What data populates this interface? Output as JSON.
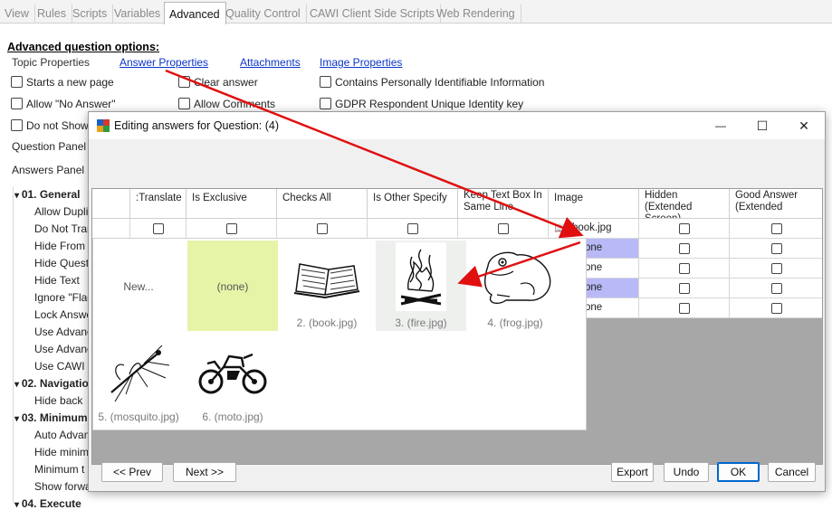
{
  "tabs": [
    "View",
    "Rules",
    "Scripts",
    "Variables",
    "Advanced",
    "Quality Control",
    "CAWI Client Side Scripts",
    "Web Rendering"
  ],
  "active_tab": "Advanced",
  "form": {
    "section_title": "Advanced question options:",
    "topic_properties": "Topic Properties",
    "links": [
      "Answer Properties",
      "Attachments",
      "Image Properties"
    ],
    "checkboxes": {
      "starts_new_page": "Starts a new page",
      "clear_answer": "Clear answer",
      "contains_pii": "Contains Personally Identifiable Information",
      "allow_no_answer": "Allow \"No Answer\"",
      "allow_comments": "Allow Comments",
      "gdpr_key": "GDPR Respondent Unique Identity key",
      "do_not_show": "Do not Show"
    },
    "question_panel": "Question Panel",
    "answers_panel": "Answers Panel H"
  },
  "tree": [
    {
      "text": "01. General",
      "header": true
    },
    {
      "text": "Allow Duplicate",
      "header": false
    },
    {
      "text": "Do Not Translate",
      "header": false
    },
    {
      "text": "Hide From",
      "header": false
    },
    {
      "text": "Hide Question",
      "header": false
    },
    {
      "text": "Hide Text",
      "header": false
    },
    {
      "text": "Ignore \"Flag",
      "header": false
    },
    {
      "text": "Lock Answers",
      "header": false
    },
    {
      "text": "Use Advanced",
      "header": false
    },
    {
      "text": "Use Advanced",
      "header": false
    },
    {
      "text": "Use CAWI E",
      "header": false
    },
    {
      "text": "02. Navigation",
      "header": true
    },
    {
      "text": "Hide back",
      "header": false
    },
    {
      "text": "03. Minimum",
      "header": true
    },
    {
      "text": "Auto Advance",
      "header": false
    },
    {
      "text": "Hide minimum",
      "header": false
    },
    {
      "text": "Minimum t",
      "header": false
    },
    {
      "text": "Show forward",
      "header": false
    },
    {
      "text": "04. Execute",
      "header": true
    }
  ],
  "dialog": {
    "title": "Editing answers for Question: (4)",
    "window_controls": {
      "minimize": "—",
      "maximize": "☐",
      "close": "✕"
    },
    "columns": [
      ":Translate",
      "Is Exclusive",
      "Checks All",
      "Is Other Specify",
      "Keep Text Box In Same Line",
      "Image",
      "Hidden (Extended Screen)",
      "Good Answer (Extended"
    ],
    "image_cells": [
      "book.jpg",
      "one",
      "one",
      "one",
      "one"
    ],
    "buttons": {
      "prev": "<< Prev",
      "next": "Next >>",
      "export": "Export",
      "undo": "Undo",
      "ok": "OK",
      "cancel": "Cancel"
    },
    "accent_color": "#0066cc",
    "selection_color": "#b9b9f8"
  },
  "picker": {
    "new_label": "New...",
    "none_label": "(none)",
    "none_color": "#e6f4a8",
    "images": [
      "2. (book.jpg)",
      "3. (fire.jpg)",
      "4. (frog.jpg)",
      "5. (mosquito.jpg)",
      "6. (moto.jpg)"
    ],
    "selected": "3. (fire.jpg)"
  },
  "annotation_color": "#e01010"
}
